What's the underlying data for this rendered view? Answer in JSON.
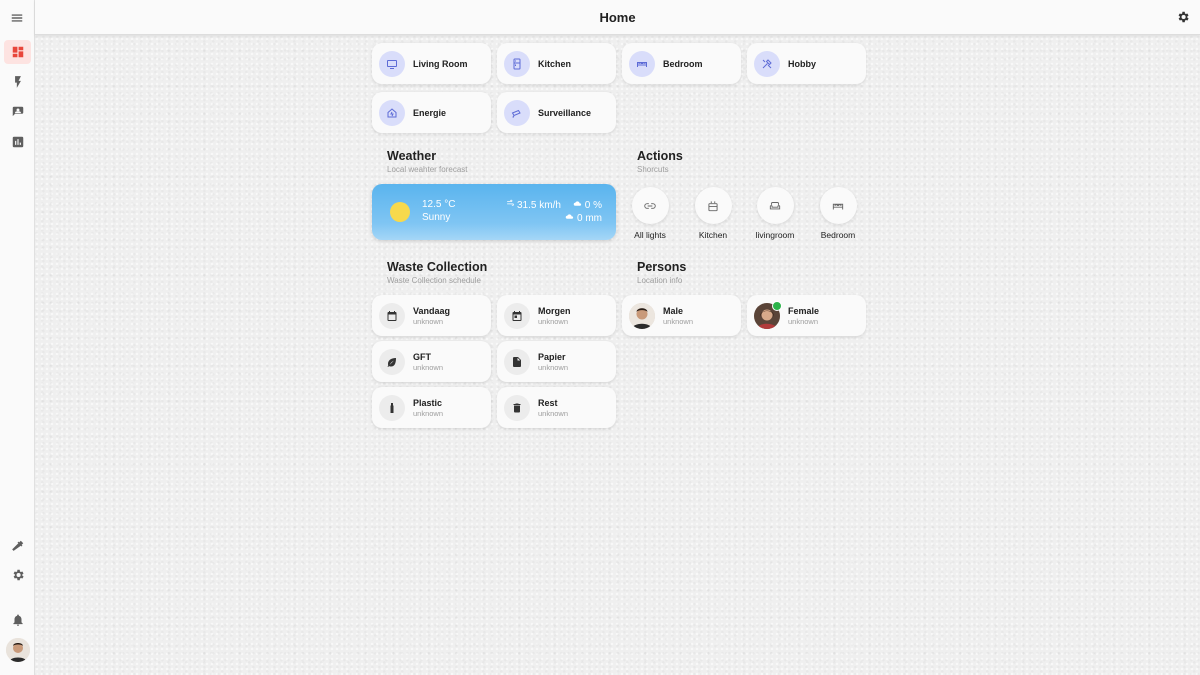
{
  "header": {
    "title": "Home"
  },
  "sidebar": {
    "items": [
      "dashboard-icon",
      "flash-icon",
      "account-box-icon",
      "chart-bar-icon"
    ],
    "bottom_items": [
      "hammer-icon",
      "cog-icon",
      "bell-icon"
    ]
  },
  "areas": [
    {
      "label": "Living Room",
      "icon": "tv-icon"
    },
    {
      "label": "Kitchen",
      "icon": "fridge-icon"
    },
    {
      "label": "Bedroom",
      "icon": "bed-icon"
    },
    {
      "label": "Hobby",
      "icon": "tools-icon"
    },
    {
      "label": "Energie",
      "icon": "home-lightning-icon"
    },
    {
      "label": "Surveillance",
      "icon": "cctv-icon"
    }
  ],
  "weather": {
    "title": "Weather",
    "subtitle": "Local weahter forecast",
    "temperature": "12.5 °C",
    "condition": "Sunny",
    "wind": "31.5 km/h",
    "precip_chance": "0 %",
    "precip_amount": "0 mm"
  },
  "actions": {
    "title": "Actions",
    "subtitle": "Shorcuts",
    "items": [
      {
        "label": "All lights",
        "icon": "link-icon"
      },
      {
        "label": "Kitchen",
        "icon": "stove-icon"
      },
      {
        "label": "livingroom",
        "icon": "sofa-icon"
      },
      {
        "label": "Bedroom",
        "icon": "bed-icon"
      }
    ]
  },
  "waste": {
    "title": "Waste Collection",
    "subtitle": "Waste Collection schedule",
    "items": [
      {
        "label": "Vandaag",
        "state": "unknown",
        "icon": "calendar-icon"
      },
      {
        "label": "Morgen",
        "state": "unknown",
        "icon": "calendar-today-icon"
      },
      {
        "label": "GFT",
        "state": "unknown",
        "icon": "leaf-icon"
      },
      {
        "label": "Papier",
        "state": "unknown",
        "icon": "file-icon"
      },
      {
        "label": "Plastic",
        "state": "unknown",
        "icon": "bottle-icon"
      },
      {
        "label": "Rest",
        "state": "unknown",
        "icon": "trash-icon"
      }
    ]
  },
  "persons": {
    "title": "Persons",
    "subtitle": "Location info",
    "items": [
      {
        "label": "Male",
        "state": "unknown"
      },
      {
        "label": "Female",
        "state": "unknown"
      }
    ]
  },
  "colors": {
    "accent": "#e8463b",
    "area_icon": "#5d6bd6",
    "area_icon_bg": "#d9ddfa",
    "weather": "#5ab4ee",
    "badge": "#2cb34a"
  }
}
